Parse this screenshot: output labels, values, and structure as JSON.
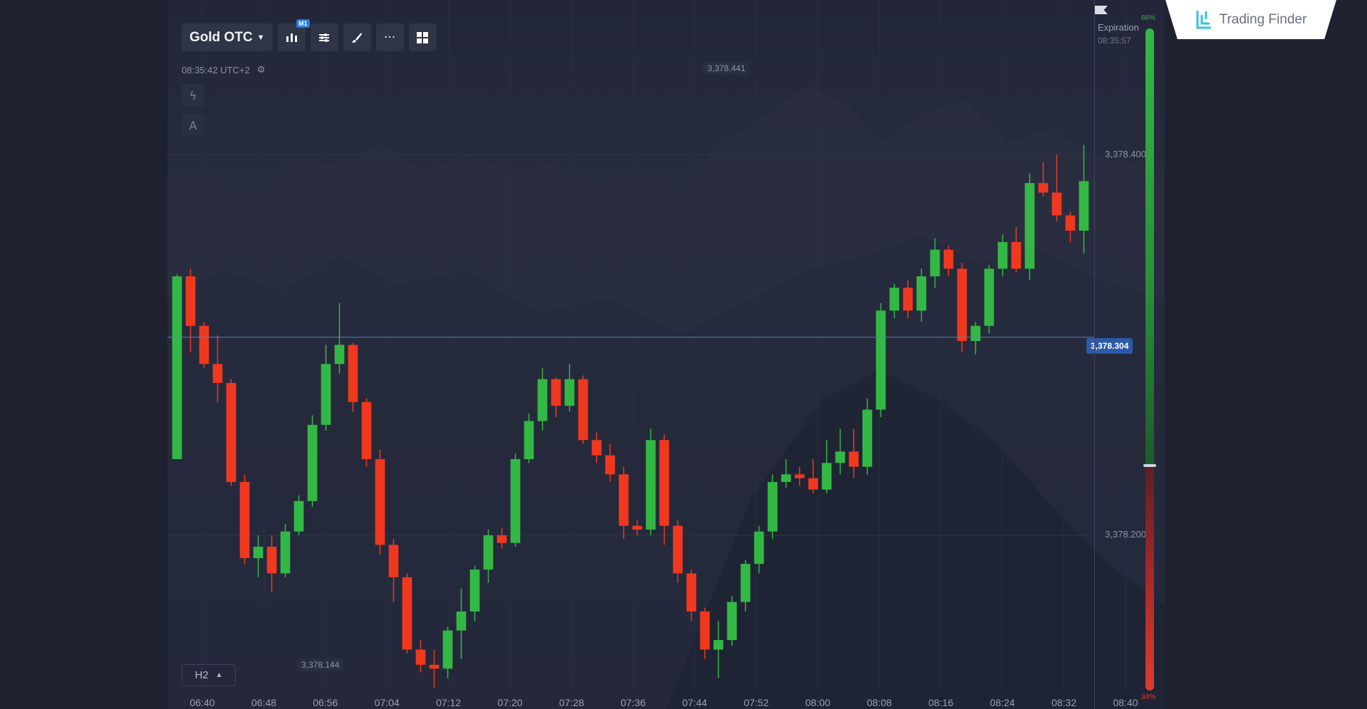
{
  "toolbar": {
    "asset_label": "Gold OTC",
    "timeframe_badge": "M1",
    "icons": [
      "chart-type-icon",
      "indicators-icon",
      "drawing-brush-icon",
      "more-dots-icon",
      "layout-grid-icon"
    ]
  },
  "clock": {
    "time": "08:35:42 UTC+2"
  },
  "side_tools": {
    "lightning": "lightning-icon",
    "text_tool": "A"
  },
  "annotations": {
    "high": "3,378.441",
    "low": "3,378.144"
  },
  "price_axis": {
    "labels": [
      "3,378.400",
      "3,378.200"
    ],
    "current": "3,378.304"
  },
  "time_axis": [
    "06:40",
    "06:48",
    "06:56",
    "07:04",
    "07:12",
    "07:20",
    "07:28",
    "07:36",
    "07:44",
    "07:52",
    "08:00",
    "08:08",
    "08:16",
    "08:24",
    "08:32",
    "08:40"
  ],
  "timeframe_selector": {
    "label": "H2"
  },
  "expiration": {
    "label": "Expiration",
    "time": "08:35:57"
  },
  "sentiment": {
    "up_pct": "66%",
    "down_pct": "34%",
    "up_fraction": 0.66
  },
  "brand": {
    "name": "Trading Finder"
  },
  "colors": {
    "up": "#34b845",
    "down": "#f0381f",
    "accent": "#2b5aa8"
  },
  "chart_data": {
    "type": "candlestick",
    "x_ticks": [
      "06:40",
      "06:48",
      "06:56",
      "07:04",
      "07:12",
      "07:20",
      "07:28",
      "07:36",
      "07:44",
      "07:52",
      "08:00",
      "08:08",
      "08:16",
      "08:24",
      "08:32",
      "08:40"
    ],
    "y_ticks": [
      3378.4,
      3378.2
    ],
    "ylim": [
      3378.13,
      3378.45
    ],
    "current_price": 3378.304,
    "annotated_high": 3378.441,
    "annotated_low": 3378.144,
    "grid": true,
    "candles": [
      [
        3378.24,
        3378.336,
        3378.337,
        3378.29
      ],
      [
        3378.336,
        3378.31,
        3378.34,
        3378.296
      ],
      [
        3378.31,
        3378.29,
        3378.312,
        3378.288
      ],
      [
        3378.29,
        3378.28,
        3378.305,
        3378.27
      ],
      [
        3378.28,
        3378.228,
        3378.282,
        3378.226
      ],
      [
        3378.228,
        3378.188,
        3378.232,
        3378.185
      ],
      [
        3378.188,
        3378.194,
        3378.2,
        3378.178
      ],
      [
        3378.194,
        3378.18,
        3378.2,
        3378.17
      ],
      [
        3378.18,
        3378.202,
        3378.206,
        3378.178
      ],
      [
        3378.202,
        3378.218,
        3378.221,
        3378.2
      ],
      [
        3378.218,
        3378.258,
        3378.263,
        3378.215
      ],
      [
        3378.258,
        3378.29,
        3378.3,
        3378.255
      ],
      [
        3378.29,
        3378.3,
        3378.322,
        3378.285
      ],
      [
        3378.3,
        3378.27,
        3378.301,
        3378.265
      ],
      [
        3378.27,
        3378.24,
        3378.272,
        3378.236
      ],
      [
        3378.24,
        3378.195,
        3378.245,
        3378.19
      ],
      [
        3378.195,
        3378.178,
        3378.198,
        3378.165
      ],
      [
        3378.178,
        3378.14,
        3378.18,
        3378.138
      ],
      [
        3378.14,
        3378.132,
        3378.145,
        3378.128
      ],
      [
        3378.132,
        3378.13,
        3378.14,
        3378.12
      ],
      [
        3378.13,
        3378.15,
        3378.152,
        3378.125
      ],
      [
        3378.15,
        3378.16,
        3378.172,
        3378.135
      ],
      [
        3378.16,
        3378.182,
        3378.184,
        3378.155
      ],
      [
        3378.182,
        3378.2,
        3378.203,
        3378.175
      ],
      [
        3378.2,
        3378.196,
        3378.204,
        3378.193
      ],
      [
        3378.196,
        3378.24,
        3378.243,
        3378.194
      ],
      [
        3378.24,
        3378.26,
        3378.264,
        3378.238
      ],
      [
        3378.26,
        3378.282,
        3378.288,
        3378.255
      ],
      [
        3378.282,
        3378.268,
        3378.283,
        3378.262
      ],
      [
        3378.268,
        3378.282,
        3378.29,
        3378.265
      ],
      [
        3378.282,
        3378.25,
        3378.284,
        3378.248
      ],
      [
        3378.25,
        3378.242,
        3378.254,
        3378.238
      ],
      [
        3378.242,
        3378.232,
        3378.248,
        3378.228
      ],
      [
        3378.232,
        3378.205,
        3378.236,
        3378.198
      ],
      [
        3378.205,
        3378.203,
        3378.208,
        3378.2
      ],
      [
        3378.203,
        3378.25,
        3378.256,
        3378.2
      ],
      [
        3378.25,
        3378.205,
        3378.253,
        3378.195
      ],
      [
        3378.205,
        3378.18,
        3378.208,
        3378.175
      ],
      [
        3378.18,
        3378.16,
        3378.182,
        3378.155
      ],
      [
        3378.16,
        3378.14,
        3378.162,
        3378.135
      ],
      [
        3378.14,
        3378.145,
        3378.155,
        3378.125
      ],
      [
        3378.145,
        3378.165,
        3378.168,
        3378.142
      ],
      [
        3378.165,
        3378.185,
        3378.187,
        3378.16
      ],
      [
        3378.185,
        3378.202,
        3378.205,
        3378.18
      ],
      [
        3378.202,
        3378.228,
        3378.232,
        3378.198
      ],
      [
        3378.228,
        3378.232,
        3378.24,
        3378.225
      ],
      [
        3378.232,
        3378.23,
        3378.236,
        3378.226
      ],
      [
        3378.23,
        3378.224,
        3378.24,
        3378.222
      ],
      [
        3378.224,
        3378.238,
        3378.25,
        3378.222
      ],
      [
        3378.238,
        3378.244,
        3378.256,
        3378.232
      ],
      [
        3378.244,
        3378.236,
        3378.256,
        3378.23
      ],
      [
        3378.236,
        3378.266,
        3378.272,
        3378.232
      ],
      [
        3378.266,
        3378.318,
        3378.322,
        3378.262
      ],
      [
        3378.318,
        3378.33,
        3378.332,
        3378.314
      ],
      [
        3378.33,
        3378.318,
        3378.334,
        3378.314
      ],
      [
        3378.318,
        3378.336,
        3378.34,
        3378.312
      ],
      [
        3378.336,
        3378.35,
        3378.356,
        3378.33
      ],
      [
        3378.35,
        3378.34,
        3378.352,
        3378.336
      ],
      [
        3378.34,
        3378.302,
        3378.343,
        3378.296
      ],
      [
        3378.302,
        3378.31,
        3378.312,
        3378.295
      ],
      [
        3378.31,
        3378.34,
        3378.342,
        3378.306
      ],
      [
        3378.34,
        3378.354,
        3378.358,
        3378.336
      ],
      [
        3378.354,
        3378.34,
        3378.362,
        3378.338
      ],
      [
        3378.34,
        3378.385,
        3378.39,
        3378.334
      ],
      [
        3378.385,
        3378.38,
        3378.396,
        3378.378
      ],
      [
        3378.38,
        3378.368,
        3378.4,
        3378.365
      ],
      [
        3378.368,
        3378.36,
        3378.37,
        3378.354
      ],
      [
        3378.36,
        3378.386,
        3378.405,
        3378.348
      ]
    ]
  }
}
